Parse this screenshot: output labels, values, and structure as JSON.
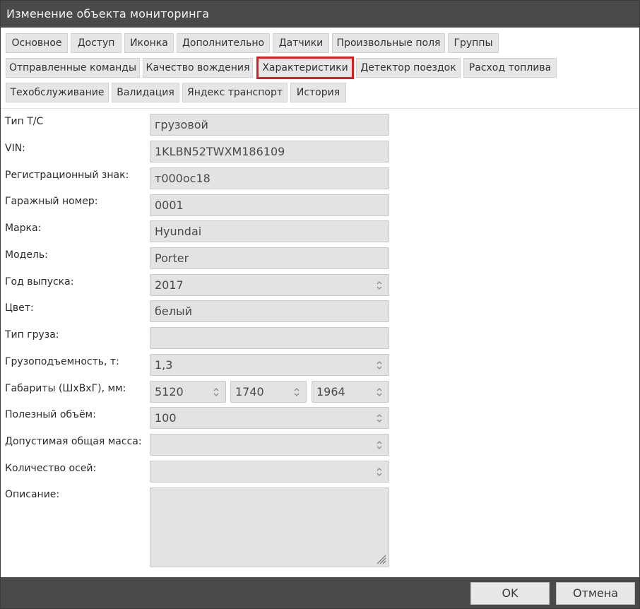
{
  "window": {
    "title": "Изменение объекта мониторинга"
  },
  "tabs": [
    "Основное",
    "Доступ",
    "Иконка",
    "Дополнительно",
    "Датчики",
    "Произвольные поля",
    "Группы",
    "Отправленные команды",
    "Качество вождения",
    "Характеристики",
    "Детектор поездок",
    "Расход топлива",
    "Техобслуживание",
    "Валидация",
    "Яндекс транспорт",
    "История"
  ],
  "active_tab": "Характеристики",
  "fields": {
    "vehicle_type": {
      "label": "Тип Т/С",
      "value": "грузовой"
    },
    "vin": {
      "label": "VIN:",
      "value": "1KLBN52TWXM186109"
    },
    "reg_sign": {
      "label": "Регистрационный знак:",
      "value": "т000ос18"
    },
    "garage_no": {
      "label": "Гаражный номер:",
      "value": "0001"
    },
    "brand": {
      "label": "Марка:",
      "value": "Hyundai"
    },
    "model": {
      "label": "Модель:",
      "value": "Porter"
    },
    "year": {
      "label": "Год выпуска:",
      "value": "2017"
    },
    "color": {
      "label": "Цвет:",
      "value": "белый"
    },
    "cargo_type": {
      "label": "Тип груза:",
      "value": ""
    },
    "capacity": {
      "label": "Грузоподъемность, т:",
      "value": "1,3"
    },
    "dimensions": {
      "label": "Габариты (ШхВхГ), мм:",
      "width": "5120",
      "height": "1740",
      "depth": "1964"
    },
    "volume": {
      "label": "Полезный объём:",
      "value": "100"
    },
    "gross_mass": {
      "label": "Допустимая общая масса:",
      "value": ""
    },
    "axles": {
      "label": "Количество осей:",
      "value": ""
    },
    "description": {
      "label": "Описание:",
      "value": ""
    }
  },
  "footer": {
    "ok": "OK",
    "cancel": "Отмена"
  }
}
